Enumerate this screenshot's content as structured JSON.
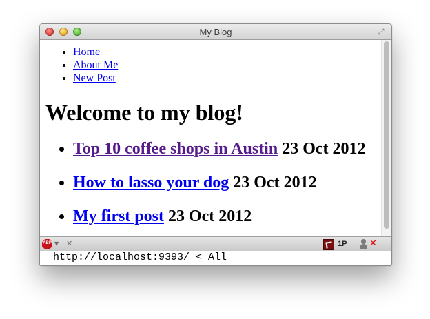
{
  "window": {
    "title": "My Blog"
  },
  "nav": [
    {
      "label": "Home"
    },
    {
      "label": "About Me"
    },
    {
      "label": "New Post"
    }
  ],
  "page_title": "Welcome to my blog!",
  "posts": [
    {
      "title": "Top 10 coffee shops in Austin",
      "date": "23 Oct 2012",
      "visited": true
    },
    {
      "title": "How to lasso your dog",
      "date": "23 Oct 2012",
      "visited": false
    },
    {
      "title": "My first post",
      "date": "23 Oct 2012",
      "visited": false
    }
  ],
  "statusbar": {
    "adblock_label": "ABP",
    "onep_label": "1P",
    "icons": [
      "adblock-icon",
      "close-icon",
      "flag-icon",
      "person-icon",
      "red-x-icon"
    ]
  },
  "url_line": "http://localhost:9393/ < All",
  "colors": {
    "link": "#0000ee",
    "visited_link": "#551a8b"
  }
}
